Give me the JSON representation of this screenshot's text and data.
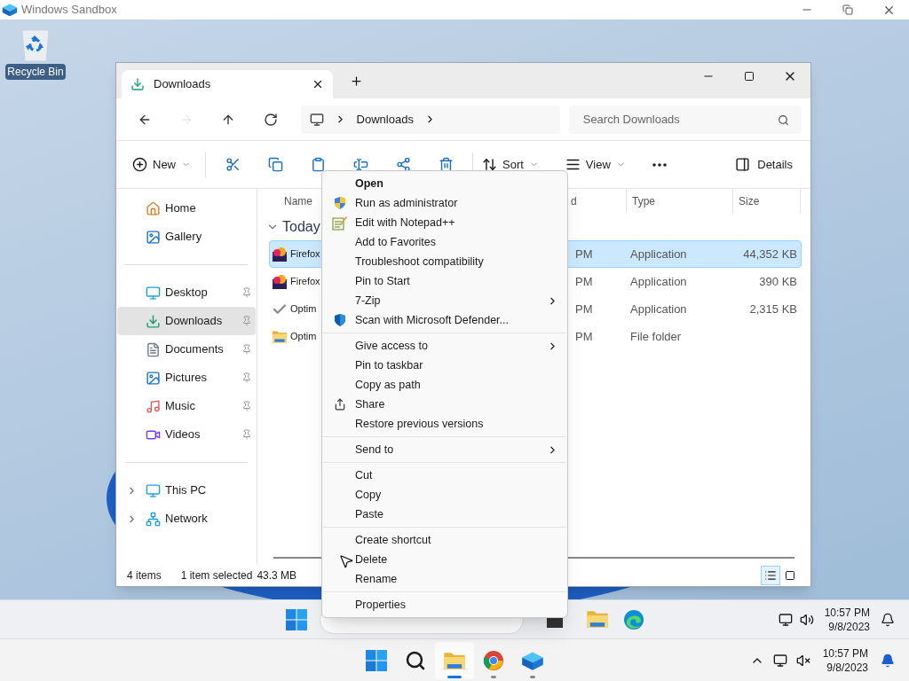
{
  "host_window": {
    "title": "Windows Sandbox"
  },
  "desktop_icons": [
    {
      "label": "Recycle Bin"
    }
  ],
  "explorer": {
    "tabs": [
      {
        "label": "Downloads",
        "selected": true
      }
    ],
    "nav_buttons": [
      {
        "kind": "back",
        "disabled": false
      },
      {
        "kind": "forward",
        "disabled": true
      },
      {
        "kind": "up",
        "disabled": false
      },
      {
        "kind": "refresh",
        "disabled": false
      }
    ],
    "breadcrumbs": [
      "Downloads"
    ],
    "search": {
      "placeholder": "Search Downloads"
    },
    "toolbar": {
      "new": "New",
      "sort": "Sort",
      "view": "View",
      "details": "Details"
    },
    "sidebar": {
      "sections": [
        {
          "items": [
            {
              "label": "Home",
              "pinned": false,
              "selected": false
            },
            {
              "label": "Gallery",
              "pinned": false,
              "selected": false
            }
          ]
        },
        {
          "items": [
            {
              "label": "Desktop",
              "pinned": true,
              "selected": false
            },
            {
              "label": "Downloads",
              "pinned": true,
              "selected": true
            },
            {
              "label": "Documents",
              "pinned": true,
              "selected": false
            },
            {
              "label": "Pictures",
              "pinned": true,
              "selected": false
            },
            {
              "label": "Music",
              "pinned": true,
              "selected": false
            },
            {
              "label": "Videos",
              "pinned": true,
              "selected": false
            }
          ]
        },
        {
          "items": [
            {
              "label": "This PC",
              "pinned": false,
              "selected": false,
              "expanded": false
            },
            {
              "label": "Network",
              "pinned": false,
              "selected": false,
              "expanded": false
            }
          ]
        }
      ]
    },
    "columns": [
      "Name",
      "d",
      "Type",
      "Size"
    ],
    "group": {
      "label": "Today",
      "expanded": true
    },
    "rows": [
      {
        "name": "Firefox",
        "date": "PM",
        "type": "Application",
        "size": "44,352 KB",
        "selected": true
      },
      {
        "name": "Firefox",
        "date": "PM",
        "type": "Application",
        "size": "390 KB",
        "selected": false
      },
      {
        "name": "Optim",
        "date": "PM",
        "type": "Application",
        "size": "2,315 KB",
        "selected": false
      },
      {
        "name": "Optim",
        "date": "PM",
        "type": "File folder",
        "size": "",
        "selected": false
      }
    ],
    "status": {
      "count": "4 items",
      "selection": "1 item selected",
      "size": "43.3 MB"
    },
    "views": [
      {
        "kind": "details",
        "selected": true
      },
      {
        "kind": "tiles",
        "selected": false
      }
    ]
  },
  "context_menu": {
    "sections": [
      {
        "items": [
          {
            "label": "Open",
            "default": true,
            "submenu": false
          },
          {
            "label": "Run as administrator",
            "default": false,
            "submenu": false
          },
          {
            "label": "Edit with Notepad++",
            "default": false,
            "submenu": false
          },
          {
            "label": "Add to Favorites",
            "default": false,
            "submenu": false
          },
          {
            "label": "Troubleshoot compatibility",
            "default": false,
            "submenu": false
          },
          {
            "label": "Pin to Start",
            "default": false,
            "submenu": false
          },
          {
            "label": "7-Zip",
            "default": false,
            "submenu": true
          },
          {
            "label": "Scan with Microsoft Defender...",
            "default": false,
            "submenu": false
          }
        ]
      },
      {
        "items": [
          {
            "label": "Give access to",
            "default": false,
            "submenu": true
          },
          {
            "label": "Pin to taskbar",
            "default": false,
            "submenu": false
          },
          {
            "label": "Copy as path",
            "default": false,
            "submenu": false
          },
          {
            "label": "Share",
            "default": false,
            "submenu": false
          },
          {
            "label": "Restore previous versions",
            "default": false,
            "submenu": false
          }
        ]
      },
      {
        "items": [
          {
            "label": "Send to",
            "default": false,
            "submenu": true
          }
        ]
      },
      {
        "items": [
          {
            "label": "Cut",
            "default": false,
            "submenu": false
          },
          {
            "label": "Copy",
            "default": false,
            "submenu": false
          },
          {
            "label": "Paste",
            "default": false,
            "submenu": false
          }
        ]
      },
      {
        "items": [
          {
            "label": "Create shortcut",
            "default": false,
            "submenu": false
          },
          {
            "label": "Delete",
            "default": false,
            "submenu": false
          },
          {
            "label": "Rename",
            "default": false,
            "submenu": false
          }
        ]
      },
      {
        "items": [
          {
            "label": "Properties",
            "default": false,
            "submenu": false
          }
        ]
      }
    ]
  },
  "sandbox_taskbar": {
    "clock": {
      "time": "10:57 PM",
      "date": "9/8/2023"
    },
    "muted": false
  },
  "host_taskbar": {
    "apps": [
      {
        "kind": "start",
        "active": false,
        "running": false
      },
      {
        "kind": "search",
        "active": false,
        "running": false
      },
      {
        "kind": "explorer",
        "active": true,
        "running": true
      },
      {
        "kind": "browser",
        "active": false,
        "running": true
      },
      {
        "kind": "sandbox",
        "active": false,
        "running": true
      }
    ],
    "clock": {
      "time": "10:57 PM",
      "date": "9/8/2023"
    },
    "muted": true
  }
}
